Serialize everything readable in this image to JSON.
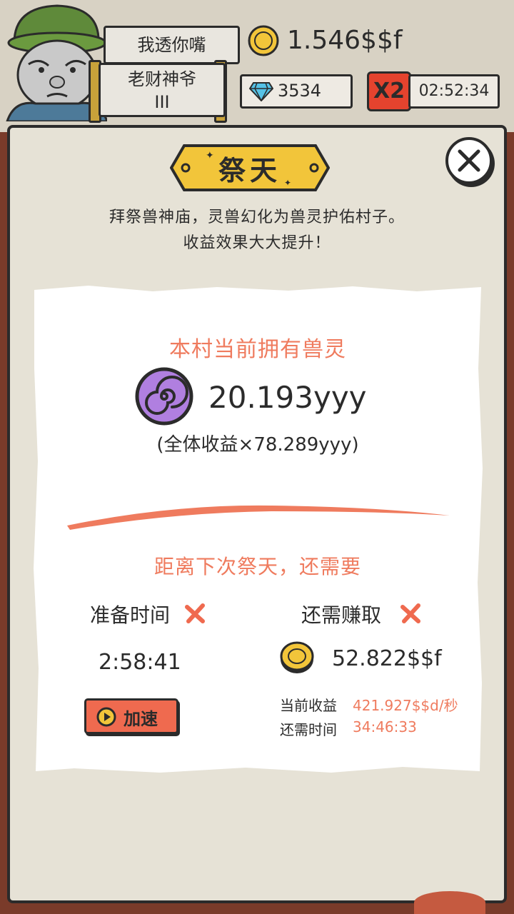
{
  "hud": {
    "sign_top": "我透你嘴",
    "sign_title_line1": "老财神爷",
    "sign_title_line2": "III",
    "gold": "1.546$$f",
    "gems": "3534",
    "multiplier": "X2",
    "timer": "02:52:34"
  },
  "dialog": {
    "title": "祭天",
    "desc_line1": "拜祭兽神庙，灵兽幻化为兽灵护佑村子。",
    "desc_line2": "收益效果大大提升！",
    "spirit_heading": "本村当前拥有兽灵",
    "spirit_count": "20.193yyy",
    "spirit_bonus": "(全体收益×78.289yyy)",
    "next_heading": "距离下次祭天，还需要",
    "prep_label": "准备时间",
    "prep_time": "2:58:41",
    "speed_button": "加速",
    "earn_label": "还需赚取",
    "earn_amount": "52.822$$f",
    "income_key": "当前收益",
    "income_val": "421.927$$d/秒",
    "remain_key": "还需时间",
    "remain_val": "34:46:33"
  },
  "colors": {
    "accent_red": "#ef7b5e",
    "button_red": "#ef6a4f",
    "title_gold": "#f2c53a",
    "spirit_purple": "#b07fe0"
  }
}
